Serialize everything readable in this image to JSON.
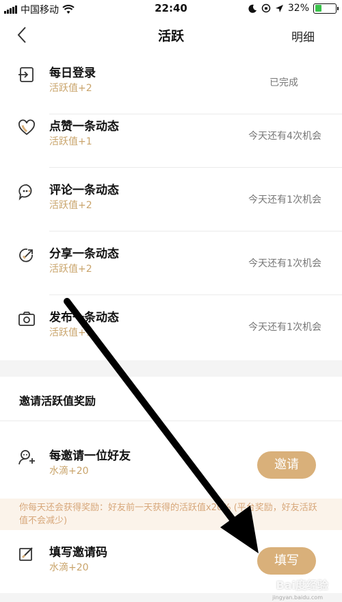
{
  "status_bar": {
    "carrier": "中国移动",
    "time": "22:40",
    "battery": "32%",
    "battery_level": 0.32,
    "battery_color": "#39c24a"
  },
  "nav": {
    "title": "活跃",
    "right_label": "明细"
  },
  "tasks": [
    {
      "title": "每日登录",
      "sub": "活跃值+2",
      "status": "已完成",
      "icon": "login-icon"
    },
    {
      "title": "点赞一条动态",
      "sub": "活跃值+1",
      "status": "今天还有4次机会",
      "icon": "heart-icon"
    },
    {
      "title": "评论一条动态",
      "sub": "活跃值+2",
      "status": "今天还有1次机会",
      "icon": "comment-icon"
    },
    {
      "title": "分享一条动态",
      "sub": "活跃值+2",
      "status": "今天还有1次机会",
      "icon": "share-icon"
    },
    {
      "title": "发布一条动态",
      "sub": "活跃值+1",
      "status": "今天还有1次机会",
      "icon": "camera-icon"
    }
  ],
  "invite_section": {
    "title": "邀请活跃值奖励",
    "invite": {
      "title": "每邀请一位好友",
      "sub": "水滴+20",
      "button": "邀请"
    },
    "notice": "你每天还会获得奖励：好友前一天获得的活跃值x20% (平台奖励，好友活跃值不会减少)",
    "code": {
      "title": "填写邀请码",
      "sub": "水滴+20",
      "button": "填写"
    }
  },
  "colors": {
    "accent": "#d9b07a",
    "sub_text": "#c9a46b",
    "notice_bg": "#fbf3ea"
  },
  "watermark": {
    "main": "Bai度经验",
    "sub": "jingyan.baidu.com"
  }
}
